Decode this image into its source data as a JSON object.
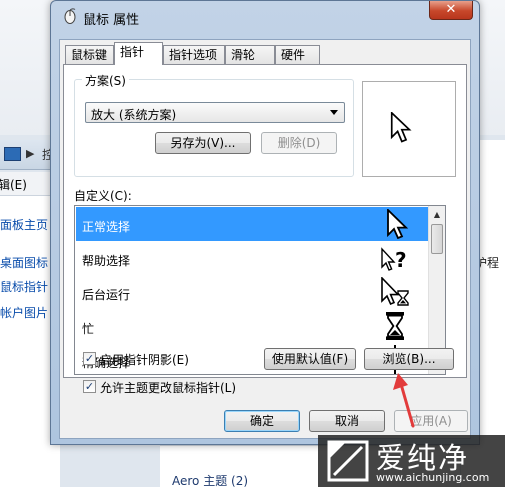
{
  "dialog": {
    "title": "鼠标 属性",
    "close_glyph": "✕",
    "tabs": [
      {
        "label": "鼠标键",
        "active": false
      },
      {
        "label": "指针",
        "active": true
      },
      {
        "label": "指针选项",
        "active": false
      },
      {
        "label": "滑轮",
        "active": false
      },
      {
        "label": "硬件",
        "active": false
      }
    ],
    "scheme": {
      "label": "方案(S)",
      "selected": "放大 (系统方案)",
      "save_as": "另存为(V)...",
      "delete": "删除(D)"
    },
    "custom": {
      "label": "自定义(C):",
      "items": [
        {
          "label": "正常选择",
          "icon": "arrow-cursor-icon",
          "selected": true
        },
        {
          "label": "帮助选择",
          "icon": "help-cursor-icon",
          "selected": false
        },
        {
          "label": "后台运行",
          "icon": "working-cursor-icon",
          "selected": false
        },
        {
          "label": "忙",
          "icon": "busy-cursor-icon",
          "selected": false
        },
        {
          "label": "精确选择",
          "icon": "crosshair-cursor-icon",
          "selected": false
        }
      ]
    },
    "enable_shadow": {
      "label": "启用指针阴影(E)",
      "checked": true
    },
    "allow_theme": {
      "label": "允许主题更改鼠标指针(L)",
      "checked": true
    },
    "use_default": "使用默认值(F)",
    "browse": "浏览(B)...",
    "ok": "确定",
    "cancel": "取消",
    "apply": "应用(A)"
  },
  "background": {
    "menu_edit": "编辑(E)",
    "address_char": "控",
    "sidebar": [
      "控制面板主页",
      "更改桌面图标",
      "更改鼠标指针",
      "更改帐户图片"
    ],
    "right_text": "保护程",
    "bottom_text": "Aero 主题 (2)"
  },
  "watermark": {
    "title": "爱纯净",
    "url": "www.aichunjing.com"
  },
  "colors": {
    "selection": "#3399ff",
    "annotation_arrow": "#e23b3b"
  }
}
